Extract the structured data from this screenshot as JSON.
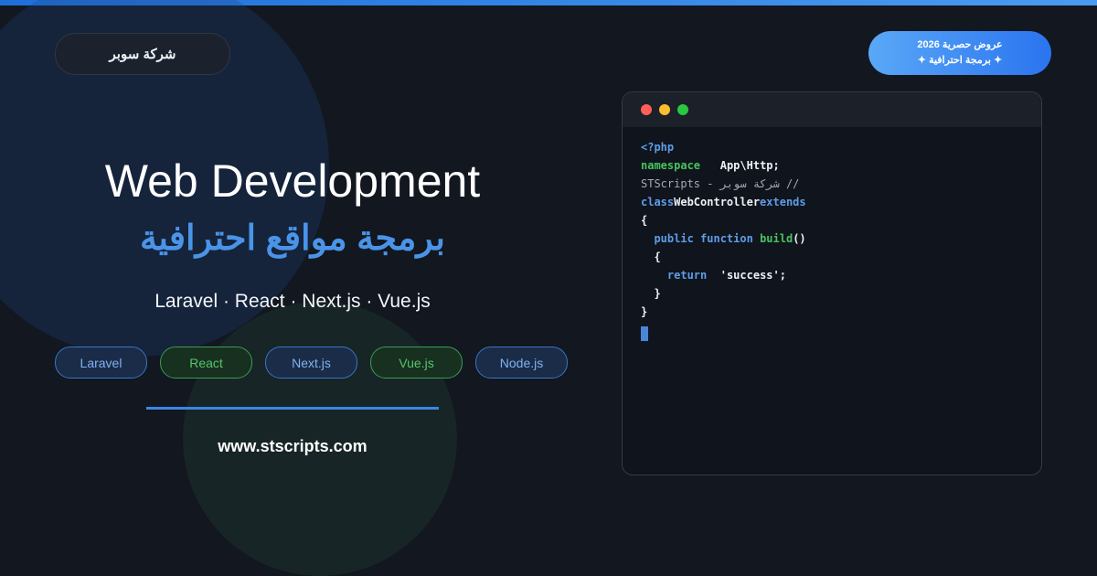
{
  "colors": {
    "background": "#121720",
    "accent_blue": "#4a94e8",
    "accent_green": "#46c35e",
    "dot_red": "#ff5f57",
    "dot_yellow": "#febc2e",
    "dot_green": "#28c840"
  },
  "brand": {
    "name": "شركة سوبر"
  },
  "offer": {
    "line1": "عروض حصرية 2026",
    "line2": "✦ برمجة احترافية ✦"
  },
  "hero": {
    "title": "Web Development",
    "subtitle": "برمجة مواقع احترافية",
    "stack": "Laravel · React · Next.js · Vue.js"
  },
  "chips": [
    {
      "label": "Laravel",
      "style": "blue"
    },
    {
      "label": "React",
      "style": "green"
    },
    {
      "label": "Next.js",
      "style": "blue"
    },
    {
      "label": "Vue.js",
      "style": "green"
    },
    {
      "label": "Node.js",
      "style": "blue"
    }
  ],
  "website": "www.stscripts.com",
  "code": {
    "open_tag": "<?php",
    "namespace_kw": "namespace",
    "namespace_name": "App\\Http;",
    "comment": "// شركة سوبر - STScripts",
    "class_kw": "class",
    "class_name": "WebController",
    "extends_kw": "extends",
    "open_brace": "{",
    "public_kw": "public function",
    "method_name": "build",
    "parens": "()",
    "inner_open": "{",
    "return_kw": "return",
    "return_val": "'success';",
    "inner_close": "}",
    "close_brace": "}"
  }
}
